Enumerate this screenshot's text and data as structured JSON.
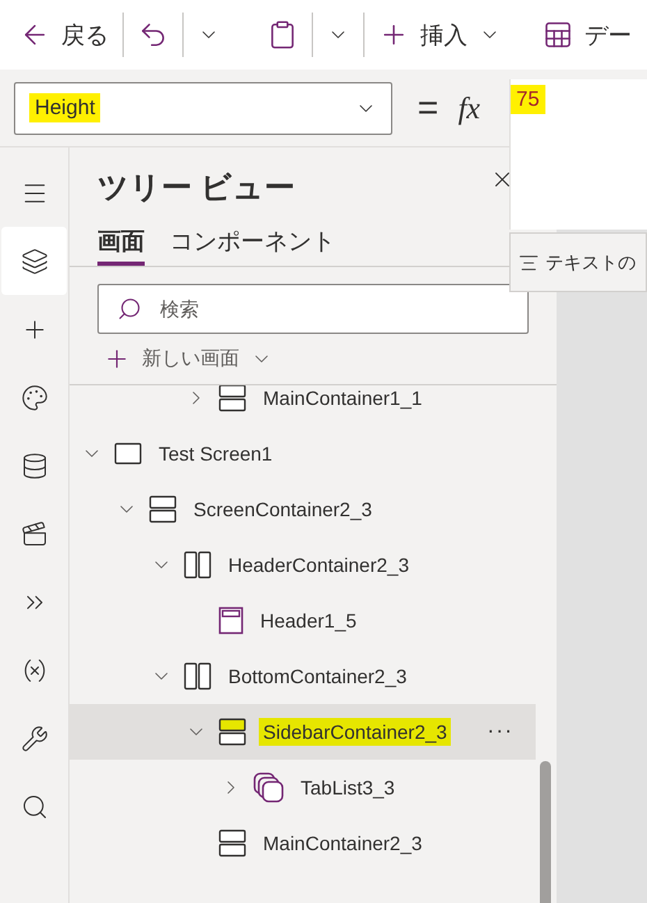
{
  "toolbar": {
    "back": "戻る",
    "insert": "挿入",
    "data": "デー"
  },
  "formula_bar": {
    "property": "Height",
    "property_highlighted": true,
    "equals": "=",
    "fx": "fx",
    "value": "75",
    "value_highlighted": true
  },
  "popup": {
    "label": "テキストの"
  },
  "rail": [
    {
      "kind": "menu",
      "selected": false
    },
    {
      "kind": "tree",
      "selected": true
    },
    {
      "kind": "insert",
      "selected": false
    },
    {
      "kind": "theme",
      "selected": false
    },
    {
      "kind": "data",
      "selected": false
    },
    {
      "kind": "media",
      "selected": false
    },
    {
      "kind": "automate",
      "selected": false
    },
    {
      "kind": "variables",
      "selected": false
    },
    {
      "kind": "tools",
      "selected": false
    },
    {
      "kind": "search",
      "selected": false
    }
  ],
  "tree_view": {
    "title": "ツリー ビュー",
    "tabs": [
      {
        "label": "画面",
        "selected": true
      },
      {
        "label": "コンポーネント",
        "selected": false
      }
    ],
    "search": {
      "placeholder": "検索"
    },
    "new_screen": "新しい画面",
    "scrolled_item": {
      "label": "MainContainer1_1",
      "kind": "vertical",
      "expanded": false,
      "selected": false
    },
    "items": [
      {
        "label": "Test Screen1",
        "kind": "screen",
        "expanded": true,
        "selected": false,
        "children": [
          {
            "label": "ScreenContainer2_3",
            "kind": "vertical",
            "expanded": true,
            "selected": false,
            "children": [
              {
                "label": "HeaderContainer2_3",
                "kind": "horizontal",
                "expanded": true,
                "selected": false,
                "children": [
                  {
                    "label": "Header1_5",
                    "kind": "header",
                    "selected": false
                  }
                ]
              },
              {
                "label": "BottomContainer2_3",
                "kind": "horizontal",
                "expanded": true,
                "selected": false,
                "children": [
                  {
                    "label": "SidebarContainer2_3",
                    "kind": "vertical",
                    "expanded": true,
                    "selected": true,
                    "highlighted": true,
                    "more": "···",
                    "children": [
                      {
                        "label": "TabList3_3",
                        "kind": "tablist",
                        "expanded": false,
                        "selected": false
                      }
                    ]
                  },
                  {
                    "label": "MainContainer2_3",
                    "kind": "vertical",
                    "selected": false
                  }
                ]
              }
            ]
          }
        ]
      }
    ]
  }
}
